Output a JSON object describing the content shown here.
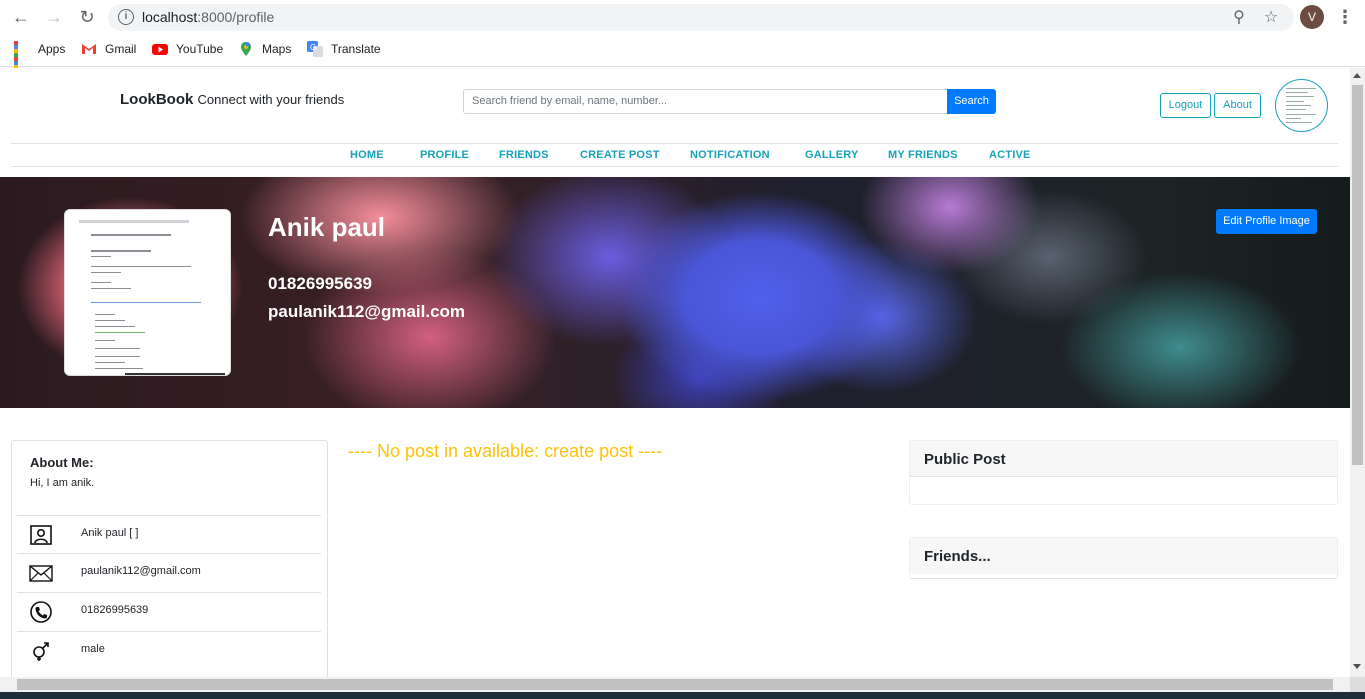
{
  "browser": {
    "url_host": "localhost",
    "url_path": ":8000/profile",
    "profile_initial": "V",
    "bookmarks": [
      {
        "label": "Apps",
        "icon": "apps-grid-icon"
      },
      {
        "label": "Gmail",
        "icon": "gmail-icon"
      },
      {
        "label": "YouTube",
        "icon": "youtube-icon"
      },
      {
        "label": "Maps",
        "icon": "maps-icon"
      },
      {
        "label": "Translate",
        "icon": "translate-icon"
      }
    ]
  },
  "header": {
    "brand_name": "LookBook",
    "brand_tagline": "Connect with your friends",
    "search_placeholder": "Search friend by email, name, number...",
    "search_label": "Search",
    "logout_label": "Logout",
    "about_label": "About"
  },
  "nav": {
    "items": [
      "HOME",
      "PROFILE",
      "FRIENDS",
      "CREATE POST",
      "NOTIFICATION",
      "GALLERY",
      "MY FRIENDS",
      "ACTIVE"
    ]
  },
  "banner": {
    "name": "Anik paul",
    "phone": "01826995639",
    "email": "paulanik112@gmail.com",
    "edit_label": "Edit Profile Image"
  },
  "about": {
    "title": "About Me:",
    "text": "Hi, I am anik.",
    "rows": [
      {
        "icon": "person-card-icon",
        "value": "Anik paul [ ]"
      },
      {
        "icon": "envelope-icon",
        "value": "paulanik112@gmail.com"
      },
      {
        "icon": "phone-icon",
        "value": "01826995639"
      },
      {
        "icon": "gender-icon",
        "value": "male"
      }
    ]
  },
  "main": {
    "no_post_message": "---- No post in available: create post ----"
  },
  "sidebar": {
    "public_post_title": "Public Post",
    "friends_title": "Friends..."
  },
  "colors": {
    "primary": "#007bff",
    "info": "#17a2b8",
    "warning": "#ffc107"
  }
}
